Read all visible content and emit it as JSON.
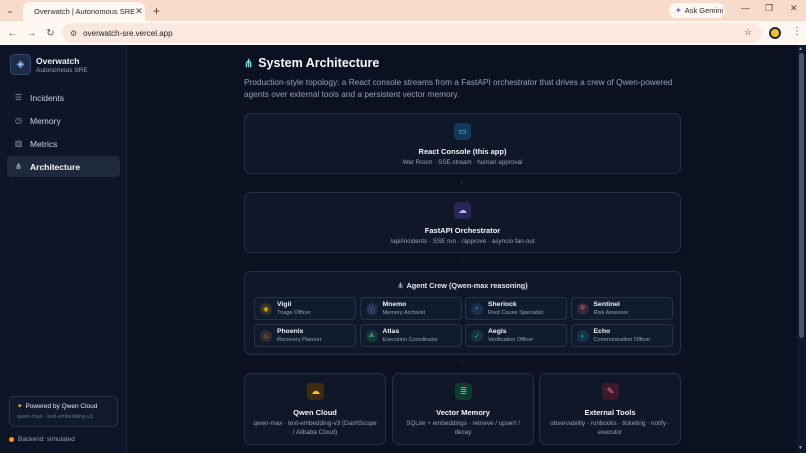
{
  "browser": {
    "tab_title": "Overwatch | Autonomous SRE",
    "url": "overwatch-sre.vercel.app",
    "ask_gemini": "Ask Gemini"
  },
  "sidebar": {
    "brand_name": "Overwatch",
    "brand_sub": "Autonomous SRE",
    "items": [
      {
        "label": "Incidents",
        "icon": "list-icon"
      },
      {
        "label": "Memory",
        "icon": "clock-icon"
      },
      {
        "label": "Metrics",
        "icon": "bar-chart-icon"
      },
      {
        "label": "Architecture",
        "icon": "network-icon"
      }
    ],
    "powered_title": "Powered by Qwen Cloud",
    "powered_sub": "qwen-max · text-embedding-v3",
    "backend": "Backend: simulated"
  },
  "page": {
    "title": "System Architecture",
    "description": "Production-style topology: a React console streams from a FastAPI orchestrator that drives a crew of Qwen-powered agents over external tools and a persistent vector memory."
  },
  "cards": {
    "console": {
      "title": "React Console (this app)",
      "sub": "War Room · SSE stream · human approval"
    },
    "orchestrator": {
      "title": "FastAPI Orchestrator",
      "sub": "/api/incidents · SSE run · /approve · asyncio fan-out"
    },
    "crew": {
      "title": "Agent Crew (Qwen-max reasoning)"
    },
    "qwen": {
      "title": "Qwen Cloud",
      "sub": "qwen-max · text-embedding-v3 (DashScope / Alibaba Cloud)"
    },
    "vector": {
      "title": "Vector Memory",
      "sub": "SQLite + embeddings · retrieve / upsert / decay"
    },
    "tools": {
      "title": "External Tools",
      "sub": "observability · runbooks · ticketing · notify · executor"
    }
  },
  "arrow_glyph": "↓",
  "agents": [
    {
      "name": "Vigil",
      "role": "Triage Officer",
      "color": "#eab308"
    },
    {
      "name": "Mnemo",
      "role": "Memory Archivist",
      "color": "#818cf8"
    },
    {
      "name": "Sherlock",
      "role": "Root Cause Specialist",
      "color": "#60a5fa"
    },
    {
      "name": "Sentinel",
      "role": "Risk Assessor",
      "color": "#f87171"
    },
    {
      "name": "Phoenix",
      "role": "Recovery Planner",
      "color": "#fb923c"
    },
    {
      "name": "Atlas",
      "role": "Execution Coordinator",
      "color": "#4ade80"
    },
    {
      "name": "Aegis",
      "role": "Verification Officer",
      "color": "#34d399"
    },
    {
      "name": "Echo",
      "role": "Communication Officer",
      "color": "#22d3ee"
    }
  ]
}
